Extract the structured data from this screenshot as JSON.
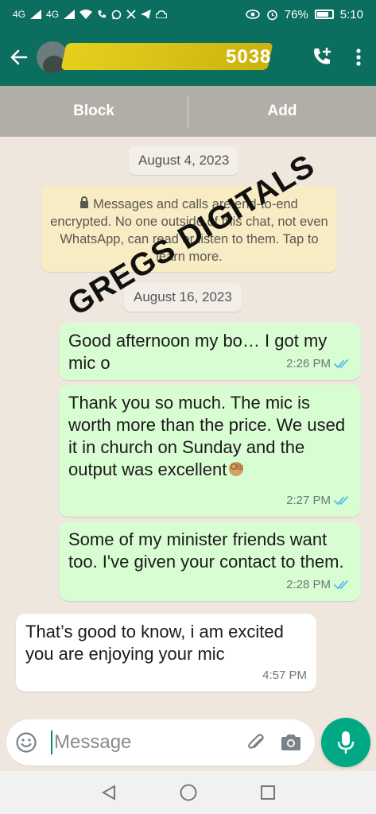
{
  "status_bar": {
    "signal_1": "4G",
    "signal_2": "4G",
    "battery": "76%",
    "time": "5:10"
  },
  "header": {
    "contact_name_visible": "5038",
    "back_icon": "arrow-left-icon",
    "call_icon": "add-call-icon",
    "menu_icon": "more-vertical-icon"
  },
  "actions": {
    "block_label": "Block",
    "add_label": "Add"
  },
  "chat": {
    "date_1": "August 4, 2023",
    "encryption_notice": "Messages and calls are end-to-end encrypted. No one outside of this chat, not even WhatsApp, can read or listen to them. Tap to learn more.",
    "date_2": "August 16, 2023",
    "messages": [
      {
        "direction": "outgoing",
        "text": "Good afternoon my bo… I got my mic o",
        "time": "2:26 PM",
        "status": "read"
      },
      {
        "direction": "outgoing",
        "text": "Thank you so much. The mic is worth more than the price. We used it in church on Sunday and the output was excellent",
        "emoji": "ok-hand",
        "time": "2:27 PM",
        "status": "read"
      },
      {
        "direction": "outgoing",
        "text": "Some of my minister friends want too. I've given your contact to them.",
        "time": "2:28 PM",
        "status": "read"
      },
      {
        "direction": "incoming",
        "text": "That’s good to know, i am excited you are enjoying your mic",
        "time": "4:57 PM"
      }
    ],
    "watermark": "GREGS DIGITALS"
  },
  "composer": {
    "placeholder": "Message",
    "emoji_icon": "smiley-icon",
    "attach_icon": "paperclip-icon",
    "camera_icon": "camera-icon",
    "mic_icon": "microphone-icon"
  },
  "colors": {
    "header": "#0b6e5f",
    "outgoing_bubble": "#d9fdd3",
    "incoming_bubble": "#ffffff",
    "accent": "#00a884",
    "read_ticks": "#53bdeb"
  }
}
